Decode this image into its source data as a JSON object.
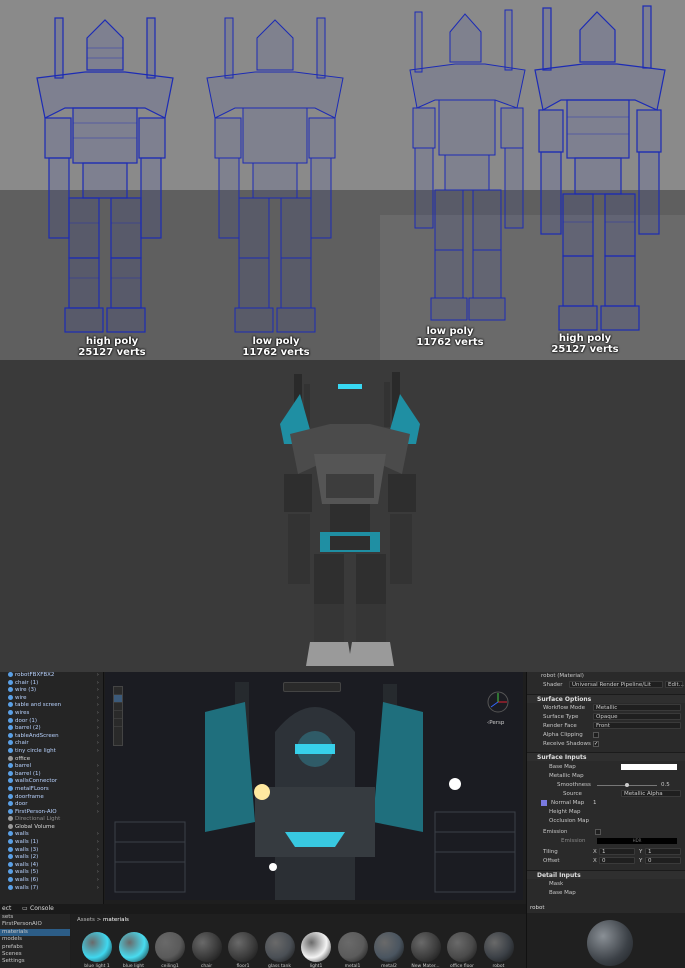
{
  "wireframe_panel": {
    "labels": [
      {
        "line1": "high poly",
        "line2": "25127 verts"
      },
      {
        "line1": "low poly",
        "line2": "11762 verts"
      },
      {
        "line1": "low poly",
        "line2": "11762 verts"
      },
      {
        "line1": "high poly",
        "line2": "25127 verts"
      }
    ]
  },
  "hierarchy": {
    "items": [
      {
        "label": "robotFBXFBX2",
        "type": "obj"
      },
      {
        "label": "chair (1)",
        "type": "obj"
      },
      {
        "label": "wire (3)",
        "type": "obj"
      },
      {
        "label": "wire",
        "type": "obj"
      },
      {
        "label": "table and screen",
        "type": "obj"
      },
      {
        "label": "wires",
        "type": "obj"
      },
      {
        "label": "door (1)",
        "type": "obj"
      },
      {
        "label": "barrel (2)",
        "type": "obj"
      },
      {
        "label": "tableAndScreen",
        "type": "obj"
      },
      {
        "label": "chair",
        "type": "obj"
      },
      {
        "label": "tiny circle light",
        "type": "obj"
      },
      {
        "label": "office",
        "type": "plain"
      },
      {
        "label": "barrel",
        "type": "obj"
      },
      {
        "label": "barrel (1)",
        "type": "obj"
      },
      {
        "label": "wallsConnector",
        "type": "obj"
      },
      {
        "label": "metalFLoors",
        "type": "obj"
      },
      {
        "label": "doorframe",
        "type": "obj"
      },
      {
        "label": "door",
        "type": "obj"
      },
      {
        "label": "FirstPerson-AIO",
        "type": "obj"
      },
      {
        "label": "Directional Light",
        "type": "dim"
      },
      {
        "label": "Global Volume",
        "type": "plain"
      },
      {
        "label": "walls",
        "type": "obj"
      },
      {
        "label": "walls (1)",
        "type": "obj"
      },
      {
        "label": "walls (3)",
        "type": "obj"
      },
      {
        "label": "walls (2)",
        "type": "obj"
      },
      {
        "label": "walls (4)",
        "type": "obj"
      },
      {
        "label": "walls (5)",
        "type": "obj"
      },
      {
        "label": "walls (6)",
        "type": "obj"
      },
      {
        "label": "walls (7)",
        "type": "obj"
      }
    ]
  },
  "scene_view": {
    "persp_label": "‹Persp"
  },
  "inspector": {
    "header": "robot (Material)",
    "shader_label": "Shader",
    "shader_value": "Universal Render Pipeline/Lit",
    "edit_label": "Edit...",
    "surface_options": "Surface Options",
    "workflow_mode": {
      "label": "Workflow Mode",
      "value": "Metallic"
    },
    "surface_type": {
      "label": "Surface Type",
      "value": "Opaque"
    },
    "render_face": {
      "label": "Render Face",
      "value": "Front"
    },
    "alpha_clipping": "Alpha Clipping",
    "receive_shadows": "Receive Shadows",
    "surface_inputs": "Surface Inputs",
    "base_map": "Base Map",
    "metallic_map": "Metallic Map",
    "smoothness": {
      "label": "Smoothness",
      "value": "0.5"
    },
    "source": {
      "label": "Source",
      "value": "Metallic Alpha"
    },
    "normal_map": {
      "label": "Normal Map",
      "value": "1"
    },
    "height_map": "Height Map",
    "occlusion_map": "Occlusion Map",
    "emission": "Emission",
    "emission_map": "Emission",
    "hdr": "HDR",
    "tiling": {
      "label": "Tiling",
      "x": "1",
      "y": "1"
    },
    "offset": {
      "label": "Offset",
      "x": "0",
      "y": "0"
    },
    "detail_inputs": "Detail Inputs",
    "mask": "Mask",
    "detail_base_map": "Base Map",
    "x_label": "X",
    "y_label": "Y"
  },
  "bottom_tabs": {
    "project": "ect",
    "console": "Console"
  },
  "project_folders": [
    "sets",
    "FirstPersonAIO",
    "materials",
    "models",
    "prefabs",
    "Scenes",
    "Settings"
  ],
  "breadcrumb": {
    "root": "Assets",
    "sep": ">",
    "current": "materials"
  },
  "materials": [
    {
      "name": "blue light 1",
      "color": "#3fd8f0"
    },
    {
      "name": "blue light",
      "color": "#48dcf0"
    },
    {
      "name": "ceiling1",
      "color": "#5a5a5a"
    },
    {
      "name": "chair",
      "color": "#3a3a3a"
    },
    {
      "name": "floor1",
      "color": "#3c3c3c"
    },
    {
      "name": "glass tank",
      "color": "#4a4f55"
    },
    {
      "name": "light1",
      "color": "#f4f4f4"
    },
    {
      "name": "metal1",
      "color": "#5b5b5b"
    },
    {
      "name": "metal2",
      "color": "#4a5560"
    },
    {
      "name": "New Mater...",
      "color": "#3d3d3d"
    },
    {
      "name": "office floor",
      "color": "#4a4a4a"
    },
    {
      "name": "robot",
      "color": "#3b4046"
    }
  ],
  "preview": {
    "title": "robot"
  },
  "colors": {
    "wire_blue": "#1a2ab8",
    "robot_teal": "#1f8fa3",
    "robot_dark": "#2e2e2e",
    "glow": "#38d8f2"
  }
}
